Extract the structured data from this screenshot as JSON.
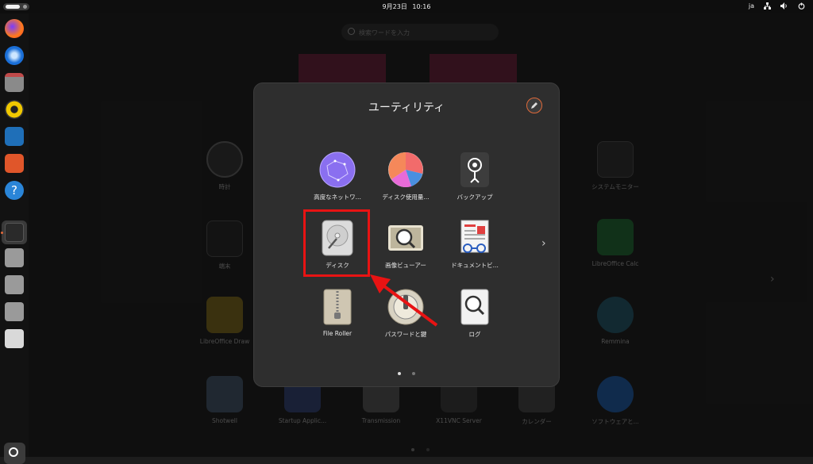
{
  "topbar": {
    "date": "9月23日",
    "time": "10:16",
    "lang": "ja"
  },
  "search": {
    "placeholder": "検索ワードを入力"
  },
  "background_apps": [
    {
      "label": "時計"
    },
    {
      "label": "端末"
    },
    {
      "label": "LibreOffice Draw"
    },
    {
      "label": "Shotwell"
    },
    {
      "label": "Startup Applic..."
    },
    {
      "label": "Transmission"
    },
    {
      "label": "X11VNC Server"
    },
    {
      "label": "カレンダー"
    },
    {
      "label": "ソフトウェアと..."
    },
    {
      "label": "システムモニター"
    },
    {
      "label": "LibreOffice Calc"
    },
    {
      "label": "Remmina"
    }
  ],
  "folder": {
    "title": "ユーティリティ",
    "apps": [
      {
        "label": "高度なネットワ..."
      },
      {
        "label": "ディスク使用量..."
      },
      {
        "label": "バックアップ"
      },
      {
        "label": "ディスク"
      },
      {
        "label": "画像ビューアー"
      },
      {
        "label": "ドキュメントビ..."
      },
      {
        "label": "File Roller"
      },
      {
        "label": "パスワードと鍵"
      },
      {
        "label": "ログ"
      }
    ],
    "next_glyph": "›"
  },
  "grid_next_glyph": "›",
  "colors": {
    "highlight": "#e81313",
    "accent": "#e06a3a"
  }
}
